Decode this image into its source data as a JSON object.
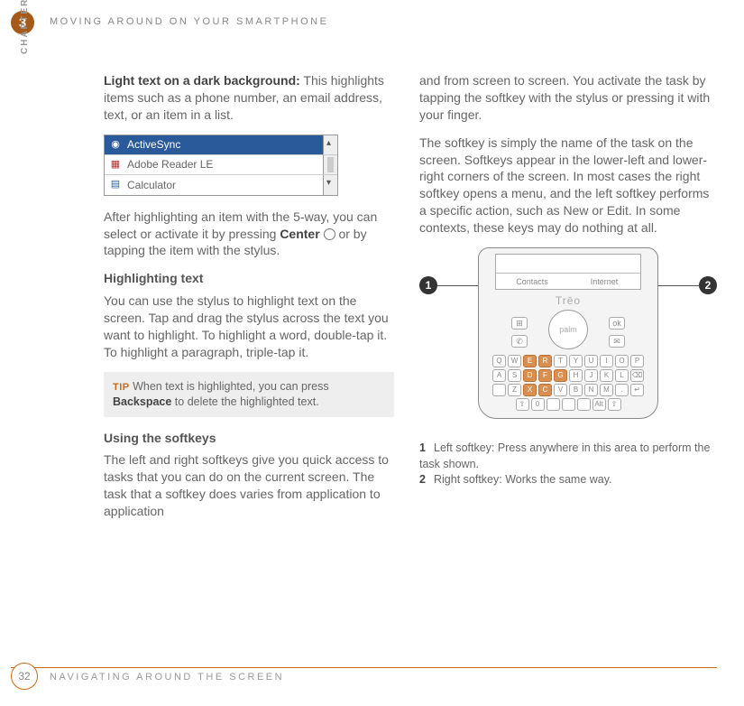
{
  "chapter_num": "3",
  "running_head": "MOVING AROUND ON YOUR SMARTPHONE",
  "chapter_label": "CHAPTER",
  "left": {
    "p1_bold": "Light text on a dark background:",
    "p1_rest": " This highlights items such as a phone number, an email address, text, or an item in a list.",
    "listbox": {
      "items": [
        "ActiveSync",
        "Adobe Reader LE",
        "Calculator"
      ]
    },
    "p2a": "After highlighting an item with the 5-way, you can select or activate it by pressing ",
    "p2_center": "Center",
    "p2b": " or by tapping the item with the stylus.",
    "h1": "Highlighting text",
    "p3": "You can use the stylus to highlight text on the screen. Tap and drag the stylus across the text you want to highlight. To highlight a word, double-tap it. To highlight a paragraph, triple-tap it.",
    "tip_label": "TIP",
    "tip_a": " When text is highlighted, you can press ",
    "tip_bold": "Backspace",
    "tip_b": " to delete the highlighted text.",
    "h2": "Using the softkeys",
    "p4": "The left and right softkeys give you quick access to tasks that you can do on the current screen. The task that a softkey does varies from application to application"
  },
  "right": {
    "p1": "and from screen to screen. You activate the task by tapping the softkey with the stylus or pressing it with your finger.",
    "p2": "The softkey is simply the name of the task on the screen. Softkeys appear in the lower-left and lower-right corners of the screen. In most cases the right softkey opens a menu, and the left softkey performs a specific action, such as New or Edit. In some contexts, these keys may do nothing at all.",
    "callouts": {
      "one": "1",
      "two": "2"
    },
    "device": {
      "brand": "Trēo",
      "nav_center": "palm",
      "softbar_left": "Contacts",
      "softbar_right": "Internet",
      "nav_ok": "ok",
      "kbd_rows": [
        [
          "Q",
          "W",
          "E",
          "R",
          "T",
          "Y",
          "U",
          "I",
          "O",
          "P"
        ],
        [
          "A",
          "S",
          "D",
          "F",
          "G",
          "H",
          "J",
          "K",
          "L",
          "⌫"
        ],
        [
          "",
          "Z",
          "X",
          "C",
          "V",
          "B",
          "N",
          "M",
          ".",
          "↵"
        ],
        [
          "⇧",
          "0",
          "",
          "",
          "",
          "Alt",
          "⇧"
        ]
      ]
    },
    "legend": [
      {
        "num": "1",
        "text": "Left softkey: Press anywhere in this area to perform the task shown."
      },
      {
        "num": "2",
        "text": "Right softkey: Works the same way."
      }
    ]
  },
  "page_num": "32",
  "footer": "NAVIGATING AROUND THE SCREEN"
}
